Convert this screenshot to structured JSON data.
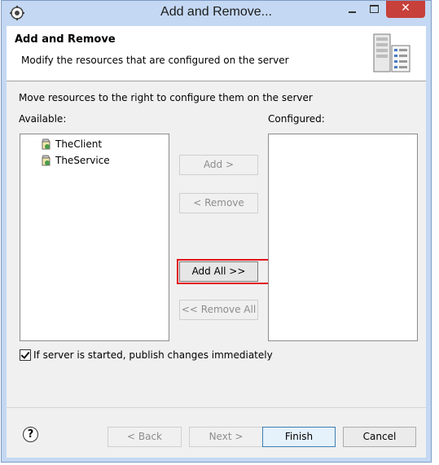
{
  "window": {
    "title": "Add and Remove...",
    "close_glyph": "✕"
  },
  "header": {
    "title": "Add and Remove",
    "description": "Modify the resources that are configured on the server"
  },
  "body": {
    "instruction": "Move resources to the right to configure them on the server",
    "available_label": "Available:",
    "configured_label": "Configured:",
    "available_items": [
      {
        "label": "TheClient",
        "icon": "web-project-icon"
      },
      {
        "label": "TheService",
        "icon": "web-project-icon"
      }
    ],
    "configured_items": []
  },
  "buttons": {
    "add": "Add >",
    "remove": "< Remove",
    "add_all": "Add All >>",
    "remove_all": "<< Remove All"
  },
  "publish": {
    "checked": true,
    "label": "If server is started, publish changes immediately"
  },
  "footer": {
    "help": "?",
    "back": "< Back",
    "next": "Next >",
    "finish": "Finish",
    "cancel": "Cancel"
  },
  "colors": {
    "highlight": "#e1131b",
    "titlebar": "#c4d8f3",
    "close_button": "#c7403a"
  }
}
